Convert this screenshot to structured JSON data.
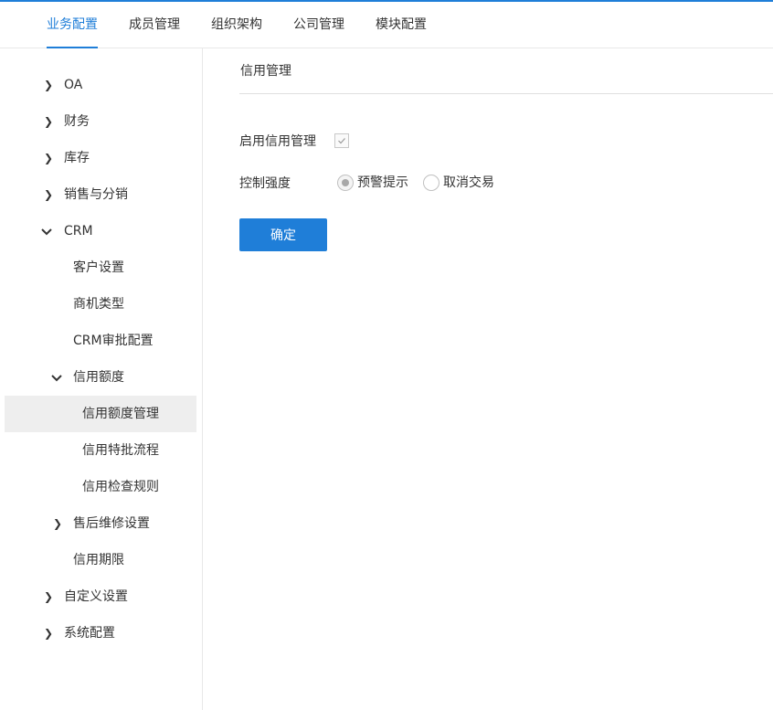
{
  "colors": {
    "accent": "#1f7ed8",
    "selected_bg": "#eeeeee",
    "border": "#e8e8e8"
  },
  "topnav": {
    "tabs": [
      {
        "label": "业务配置",
        "active": true
      },
      {
        "label": "成员管理",
        "active": false
      },
      {
        "label": "组织架构",
        "active": false
      },
      {
        "label": "公司管理",
        "active": false
      },
      {
        "label": "模块配置",
        "active": false
      }
    ]
  },
  "sidebar": {
    "items": [
      {
        "label": "OA",
        "icon": "chevron-right-icon"
      },
      {
        "label": "财务",
        "icon": "chevron-right-icon"
      },
      {
        "label": "库存",
        "icon": "chevron-right-icon"
      },
      {
        "label": "销售与分销",
        "icon": "chevron-right-icon"
      },
      {
        "label": "CRM",
        "icon": "chevron-down-icon"
      },
      {
        "label": "客户设置"
      },
      {
        "label": "商机类型"
      },
      {
        "label": "CRM审批配置"
      },
      {
        "label": "信用额度",
        "icon": "chevron-down-icon"
      },
      {
        "label": "信用额度管理",
        "selected": true
      },
      {
        "label": "信用特批流程"
      },
      {
        "label": "信用检查规则"
      },
      {
        "label": "售后维修设置",
        "icon": "chevron-right-icon"
      },
      {
        "label": "信用期限"
      },
      {
        "label": "自定义设置",
        "icon": "chevron-right-icon"
      },
      {
        "label": "系统配置",
        "icon": "chevron-right-icon"
      }
    ]
  },
  "main": {
    "title": "信用管理",
    "enable_label": "启用信用管理",
    "enable_checked": true,
    "strength_label": "控制强度",
    "strength_options": [
      {
        "label": "预警提示",
        "checked": true
      },
      {
        "label": "取消交易",
        "checked": false
      }
    ],
    "confirm_label": "确定"
  }
}
